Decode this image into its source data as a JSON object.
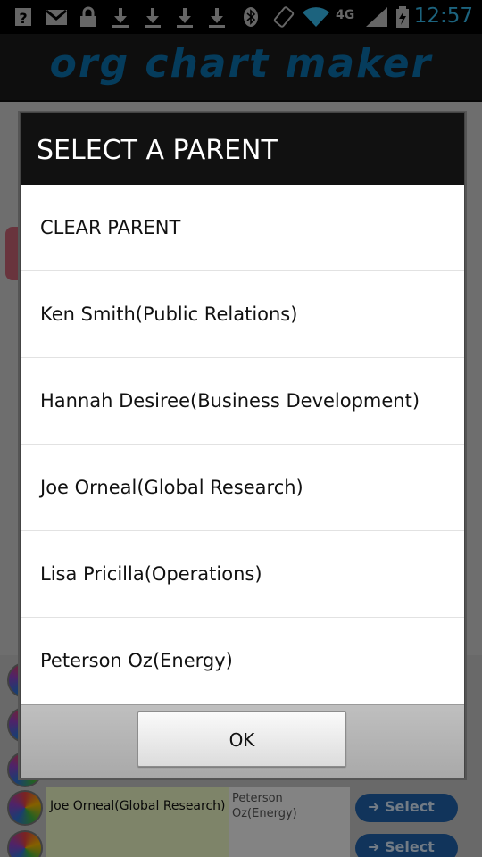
{
  "status_bar": {
    "time": "12:57",
    "network": "4G",
    "icons": [
      "help-icon",
      "gmail-icon",
      "lock-icon",
      "download-icon",
      "download-icon",
      "download-icon",
      "download-icon",
      "bluetooth-icon",
      "rotate-icon",
      "wifi-icon",
      "signal-icon",
      "battery-icon"
    ]
  },
  "app": {
    "title": "Org Chart Maker"
  },
  "background_table": {
    "rows": [
      {
        "name": "Joe Orneal(Global Research)",
        "parent": "Peterson Oz(Energy)",
        "select_label": "Select"
      },
      {
        "name": "",
        "parent": "",
        "select_label": "Select"
      }
    ]
  },
  "dialog": {
    "title": "SELECT A PARENT",
    "items": [
      "CLEAR PARENT",
      "Ken Smith(Public Relations)",
      "Hannah Desiree(Business Development)",
      "Joe Orneal(Global Research)",
      "Lisa Pricilla(Operations)",
      "Peterson Oz(Energy)"
    ],
    "ok_label": "OK"
  },
  "colors": {
    "accent": "#33b5e5",
    "app_title": "#0a6ea8",
    "select_button": "#1f5fa6"
  }
}
